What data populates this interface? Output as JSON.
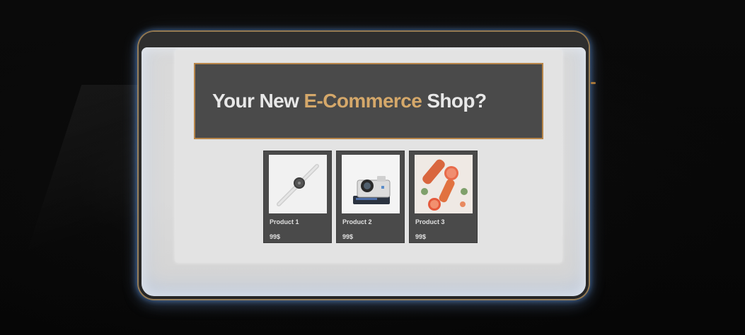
{
  "hero": {
    "title_prefix": "Your New ",
    "title_accent": "E-Commerce",
    "title_suffix": " Shop?",
    "accent_color": "#d5a86a"
  },
  "products": [
    {
      "name": "Product 1",
      "price": "99$",
      "image_icon": "smartwatch-icon"
    },
    {
      "name": "Product 2",
      "price": "99$",
      "image_icon": "camera-icon"
    },
    {
      "name": "Product 3",
      "price": "99$",
      "image_icon": "fruit-carrots-icon"
    }
  ],
  "colors": {
    "card_background": "#4a4a4a",
    "hero_border": "#b8864a",
    "page_panel": "#e3e3e3"
  }
}
